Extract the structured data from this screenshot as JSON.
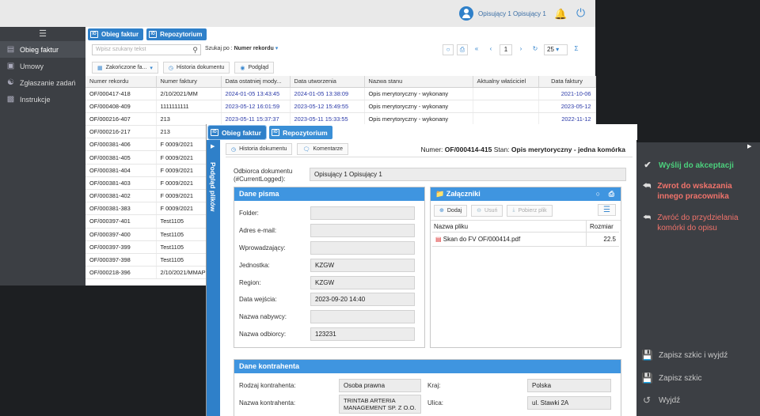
{
  "header": {
    "user_name": "Opisujący 1 Opisujący 1"
  },
  "sidebar": {
    "items": [
      {
        "label": "Obieg faktur",
        "icon": "invoice-icon",
        "active": true
      },
      {
        "label": "Umowy",
        "icon": "document-icon",
        "active": false
      },
      {
        "label": "Zgłaszanie zadań",
        "icon": "handshake-icon",
        "active": false
      },
      {
        "label": "Instrukcje",
        "icon": "book-icon",
        "active": false
      }
    ]
  },
  "tabs": [
    {
      "label": "Obieg faktur"
    },
    {
      "label": "Repozytorium"
    }
  ],
  "search": {
    "placeholder": "Wpisz szukany tekst",
    "by_label": "Szukaj po :",
    "by_value": "Numer rekordu"
  },
  "pager": {
    "page": "1",
    "page_size": "25"
  },
  "toolbar": {
    "filter_label": "Zakończone fa...",
    "history_label": "Historia dokumentu",
    "preview_label": "Podgląd"
  },
  "table": {
    "columns": [
      "Numer rekordu",
      "Numer faktury",
      "Data ostatniej mody...",
      "Data utworzenia",
      "Nazwa stanu",
      "Aktualny właściciel",
      "Data faktury"
    ],
    "rows": [
      [
        "OF/000417-418",
        "2/10/2021/MM",
        "2024-01-05 13:43:45",
        "2024-01-05 13:38:09",
        "Opis merytoryczny - wykonany",
        "",
        "2021-10-06"
      ],
      [
        "OF/000408-409",
        "1111111111",
        "2023-05-12 16:01:59",
        "2023-05-12 15:49:55",
        "Opis merytoryczny - wykonany",
        "",
        "2023-05-12"
      ],
      [
        "OF/000216-407",
        "213",
        "2023-05-11 15:37:37",
        "2023-05-11 15:33:55",
        "Opis merytoryczny - wykonany",
        "",
        "2022-11-12"
      ],
      [
        "OF/000216-217",
        "213",
        "",
        "",
        "",
        "",
        ""
      ],
      [
        "OF/000381-406",
        "F 0009/2021",
        "",
        "",
        "",
        "",
        ""
      ],
      [
        "OF/000381-405",
        "F 0009/2021",
        "",
        "",
        "",
        "",
        ""
      ],
      [
        "OF/000381-404",
        "F 0009/2021",
        "",
        "",
        "",
        "",
        ""
      ],
      [
        "OF/000381-403",
        "F 0009/2021",
        "",
        "",
        "",
        "",
        ""
      ],
      [
        "OF/000381-402",
        "F 0009/2021",
        "",
        "",
        "",
        "",
        ""
      ],
      [
        "OF/000381-383",
        "F 0009/2021",
        "",
        "",
        "",
        "",
        ""
      ],
      [
        "OF/000397-401",
        "Test1105",
        "",
        "",
        "",
        "",
        ""
      ],
      [
        "OF/000397-400",
        "Test1105",
        "",
        "",
        "",
        "",
        ""
      ],
      [
        "OF/000397-399",
        "Test1105",
        "",
        "",
        "",
        "",
        ""
      ],
      [
        "OF/000397-398",
        "Test1105",
        "",
        "",
        "",
        "",
        ""
      ],
      [
        "OF/000218-396",
        "2/10/2021/MMAP",
        "",
        "",
        "",
        "",
        ""
      ]
    ]
  },
  "front": {
    "side_label": "Podgląd plików",
    "history_label": "Historia dokumentu",
    "comments_label": "Komentarze",
    "numer_label": "Numer:",
    "numer_value": "OF/000414-415",
    "stan_label": "Stan:",
    "stan_value": "Opis merytoryczny - jedna komórka",
    "odbiorca_label": "Odbiorca dokumentu (#CurrentLogged):",
    "odbiorca_value": "Opisujący 1 Opisujący 1",
    "dane_pisma": {
      "title": "Dane pisma",
      "fields": [
        {
          "label": "Folder:",
          "value": ""
        },
        {
          "label": "Adres e-mail:",
          "value": ""
        },
        {
          "label": "Wprowadzający:",
          "value": ""
        },
        {
          "label": "Jednostka:",
          "value": "KZGW"
        },
        {
          "label": "Region:",
          "value": "KZGW"
        },
        {
          "label": "Data wejścia:",
          "value": "2023-09-20 14:40"
        },
        {
          "label": "Nazwa nabywcy:",
          "value": ""
        },
        {
          "label": "Nazwa odbiorcy:",
          "value": "123231"
        }
      ]
    },
    "zalaczniki": {
      "title": "Załączniki",
      "add_label": "Dodaj",
      "delete_label": "Usuń",
      "download_label": "Pobierz plik",
      "col_name": "Nazwa pliku",
      "col_size": "Rozmiar",
      "file_name": "Skan do FV OF/000414.pdf",
      "file_size": "22.5"
    },
    "kontrahent": {
      "title": "Dane kontrahenta",
      "rodzaj_label": "Rodzaj kontrahenta:",
      "rodzaj_value": "Osoba prawna",
      "kraj_label": "Kraj:",
      "kraj_value": "Polska",
      "nazwa_label": "Nazwa kontrahenta:",
      "nazwa_value": "TRINTAB ARTERIA MANAGEMENT SP. Z O.O.",
      "ulica_label": "Ulica:",
      "ulica_value": "ul. Stawki 2A"
    }
  },
  "actions": {
    "accept": "Wyślij do akceptacji",
    "return_worker": "Zwrot do wskazania innego pracownika",
    "return_cell": "Zwróć do przydzielania komórki do opisu",
    "save_exit": "Zapisz szkic i wyjdź",
    "save": "Zapisz szkic",
    "exit": "Wyjdź"
  },
  "colors": {
    "accent": "#2f80c9",
    "success": "#4cd07d",
    "danger": "#f0736b",
    "sidebar": "#3c3f44"
  }
}
